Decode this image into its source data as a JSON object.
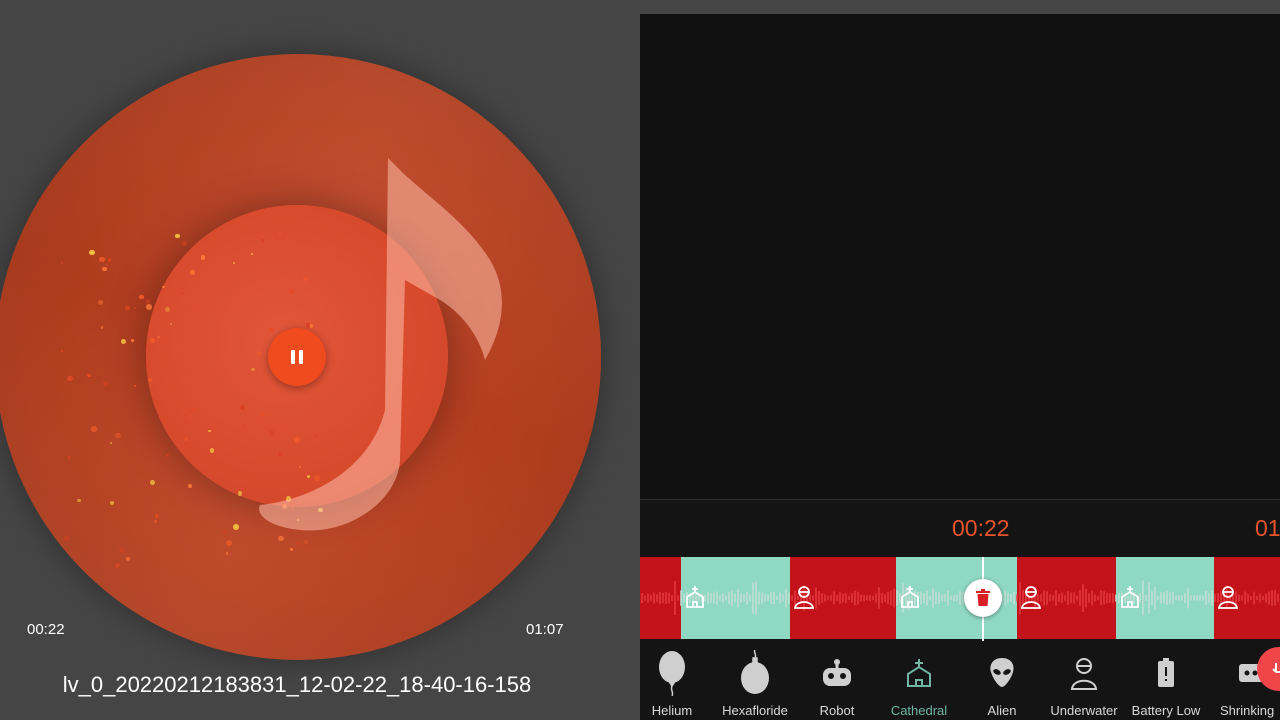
{
  "player": {
    "current_time": "00:22",
    "total_time": "01:07",
    "filename": "lv_0_20220212183831_12-02-22_18-40-16-158",
    "state": "playing",
    "accent": "#f04a1f"
  },
  "editor": {
    "current_time": "00:22",
    "next_time_partial": "01",
    "colors": {
      "timeline_red": "#c3121a",
      "effect_teal": "#8fd9c2",
      "time_text": "#e8542a",
      "active_effect": "#6fb5a2"
    },
    "segments": [
      {
        "type": "none"
      },
      {
        "type": "effect",
        "effect": "Cathedral"
      },
      {
        "type": "none"
      },
      {
        "type": "effect",
        "effect": "Cathedral"
      },
      {
        "type": "none"
      },
      {
        "type": "effect",
        "effect": "Cathedral"
      },
      {
        "type": "none"
      }
    ],
    "effects": [
      {
        "label": "Helium",
        "icon": "balloon-icon",
        "active": false
      },
      {
        "label": "Hexafloride",
        "icon": "bomb-icon",
        "active": false
      },
      {
        "label": "Robot",
        "icon": "robot-icon",
        "active": false
      },
      {
        "label": "Cathedral",
        "icon": "church-icon",
        "active": true
      },
      {
        "label": "Alien",
        "icon": "alien-icon",
        "active": false
      },
      {
        "label": "Underwater",
        "icon": "diver-icon",
        "active": false
      },
      {
        "label": "Battery Low",
        "icon": "battery-icon",
        "active": false
      },
      {
        "label": "Shrinking",
        "icon": "shrink-icon",
        "active": false
      }
    ]
  }
}
